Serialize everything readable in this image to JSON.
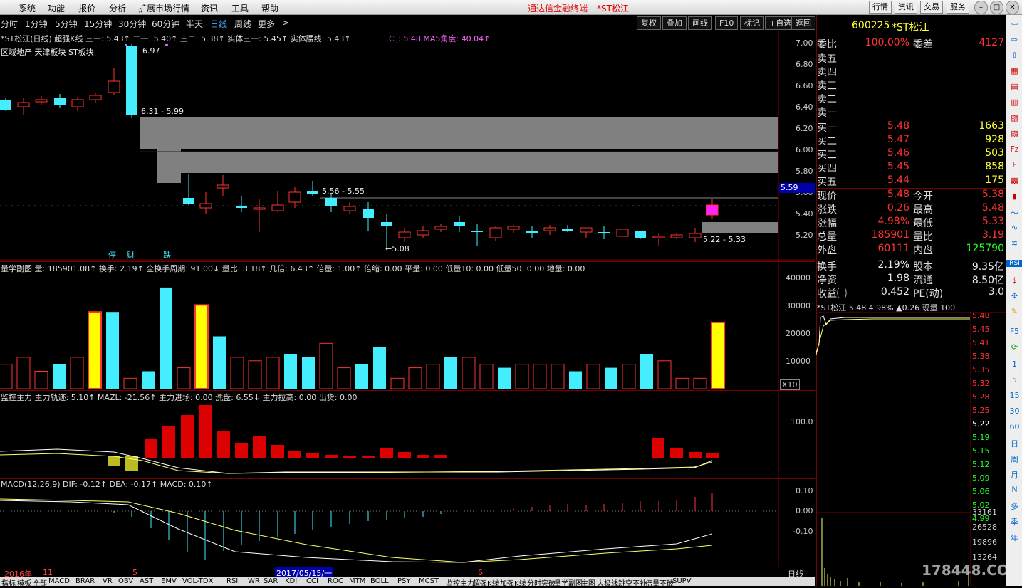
{
  "menubar": {
    "items": [
      "系统",
      "功能",
      "报价",
      "分析",
      "扩展市场行情",
      "资讯",
      "工具",
      "帮助"
    ],
    "brand": "通达信金融终端",
    "stock_title": "*ST松江",
    "right_buttons": [
      "行情",
      "资讯",
      "交易",
      "服务"
    ]
  },
  "periods": {
    "items": [
      "分时",
      "1分钟",
      "5分钟",
      "15分钟",
      "30分钟",
      "60分钟",
      "半天",
      "日线",
      "周线",
      "更多"
    ],
    "active": "日线",
    "more_arrow": ">"
  },
  "toolbar": {
    "buttons": [
      "复权",
      "叠加",
      "画线",
      "F10",
      "标记",
      "+自选",
      "返回"
    ]
  },
  "main_chart": {
    "indicator_line": "*ST松江(日线) 超强K线 三一: 5.43↑ 二一: 5.40↑ 三二: 5.38↑ 实体三一: 5.45↑ 实体腰线: 5.43↑",
    "extra_line": "C_: 5.48 MA5角度: 40.04↑",
    "tags": "区域地产 天津板块 ST板块",
    "ann_high": "6.97",
    "ann_box1": "6.31 - 5.99",
    "ann_box2": "5.56 - 5.55",
    "ann_low": "←5.08",
    "ann_box3": "5.22 - 5.33",
    "labels_bottom": [
      "停",
      "财",
      "跌"
    ],
    "price_axis": [
      "7.00",
      "6.80",
      "6.60",
      "6.40",
      "6.20",
      "6.00",
      "5.80",
      "5.60",
      "5.40",
      "5.20"
    ],
    "current_price_tag": "5.59"
  },
  "volume_chart": {
    "indicator_line": "量学副图 量: 185901.08↑ 换手: 2.19↑ 全换手周期: 91.00↓ 量比: 3.18↑ 几倍: 6.43↑ 倍量: 1.00↑ 倍缩: 0.00 平量: 0.00 低量10: 0.00 低量50: 0.00 地量: 0.00",
    "axis": [
      "40000",
      "30000",
      "20000",
      "10000"
    ],
    "unit": "X10",
    "values": [
      7,
      9,
      5,
      7,
      9,
      22,
      22,
      3,
      5,
      29,
      6,
      24,
      15,
      9,
      8,
      9,
      10,
      9,
      13,
      6,
      7,
      12,
      3,
      6,
      7,
      9,
      9,
      7,
      6,
      7,
      7,
      7,
      5,
      7,
      6,
      7,
      10,
      8,
      3,
      3,
      19
    ]
  },
  "monitor_chart": {
    "indicator_line": "监控主力 主力轨迹: 5.10↑ MAZL: -21.56↑ 主力进场: 0.00 洗盘: 6.55↓ 主力拉高: 0.00 出货: 0.00",
    "axis": [
      "100.0"
    ]
  },
  "macd_chart": {
    "indicator_line": "MACD(12,26,9) DIF: -0.12↑ DEA: -0.17↑ MACD: 0.10↑",
    "axis": [
      "0.10",
      "0.00",
      "-0.10"
    ]
  },
  "date_bar": {
    "year": "2016年",
    "m11": "11",
    "m5": "5",
    "date": "2017/05/15/一",
    "m6": "6",
    "right": "日线"
  },
  "quote": {
    "code": "600225",
    "name": "*ST松江",
    "weibi_label": "委比",
    "weibi": "100.00%",
    "weicha_label": "委差",
    "weicha": "4127",
    "sells": [
      {
        "label": "卖五",
        "price": "",
        "vol": ""
      },
      {
        "label": "卖四",
        "price": "",
        "vol": ""
      },
      {
        "label": "卖三",
        "price": "",
        "vol": ""
      },
      {
        "label": "卖二",
        "price": "",
        "vol": ""
      },
      {
        "label": "卖一",
        "price": "",
        "vol": ""
      }
    ],
    "buys": [
      {
        "label": "买一",
        "price": "5.48",
        "vol": "1663"
      },
      {
        "label": "买二",
        "price": "5.47",
        "vol": "928"
      },
      {
        "label": "买三",
        "price": "5.46",
        "vol": "503"
      },
      {
        "label": "买四",
        "price": "5.45",
        "vol": "858"
      },
      {
        "label": "买五",
        "price": "5.44",
        "vol": "175"
      }
    ],
    "stats": [
      {
        "l1": "现价",
        "v1": "5.48",
        "l2": "今开",
        "v2": "5.38"
      },
      {
        "l1": "涨跌",
        "v1": "0.26",
        "l2": "最高",
        "v2": "5.48"
      },
      {
        "l1": "涨幅",
        "v1": "4.98%",
        "l2": "最低",
        "v2": "5.33"
      },
      {
        "l1": "总量",
        "v1": "185901",
        "l2": "量比",
        "v2": "3.19"
      },
      {
        "l1": "外盘",
        "v1": "60111",
        "l2": "内盘",
        "v2": "125790"
      }
    ],
    "fund": [
      {
        "l1": "换手",
        "v1": "2.19%",
        "l2": "股本",
        "v2": "9.35亿"
      },
      {
        "l1": "净资",
        "v1": "1.98",
        "l2": "流通",
        "v2": "8.50亿"
      },
      {
        "l1": "收益㈠",
        "v1": "0.452",
        "l2": "PE(动)",
        "v2": "3.0"
      }
    ]
  },
  "mini_chart": {
    "header": "*ST松江 5.48 4.98% ▲0.26 现量 100",
    "price_axis": [
      "5.48",
      "5.45",
      "5.41",
      "5.38",
      "5.35",
      "5.32",
      "5.28",
      "5.25",
      "5.22",
      "5.19",
      "5.15",
      "5.12",
      "5.09",
      "5.06",
      "5.02",
      "4.99"
    ],
    "vol_axis": [
      "33161",
      "26528",
      "19896",
      "13264"
    ]
  },
  "sidebar": {
    "items": [
      "1",
      "5",
      "15",
      "30",
      "60",
      "日",
      "周",
      "月",
      "N",
      "多",
      "季",
      "年"
    ]
  },
  "bottom_tabs": [
    "指标",
    "模板",
    "全部",
    "MACD",
    "BRAR",
    "VR",
    "OBV",
    "AST",
    "EMV",
    "VOL-TDX",
    "RSI",
    "WR",
    "SAR",
    "KDJ",
    "CCI",
    "ROC",
    "MTM",
    "BOLL",
    "PSY",
    "MCST",
    "监控主力",
    "超强K线",
    "加强K线",
    "分时突破",
    "量学副图",
    "主图",
    "大极线",
    "跳空不补",
    "倍量不破",
    "SUPV"
  ],
  "watermark": "178448.COM",
  "colors": {
    "up": "#ff3333",
    "down": "#44eeff",
    "grid": "#770000",
    "gray_box": "#808080"
  }
}
